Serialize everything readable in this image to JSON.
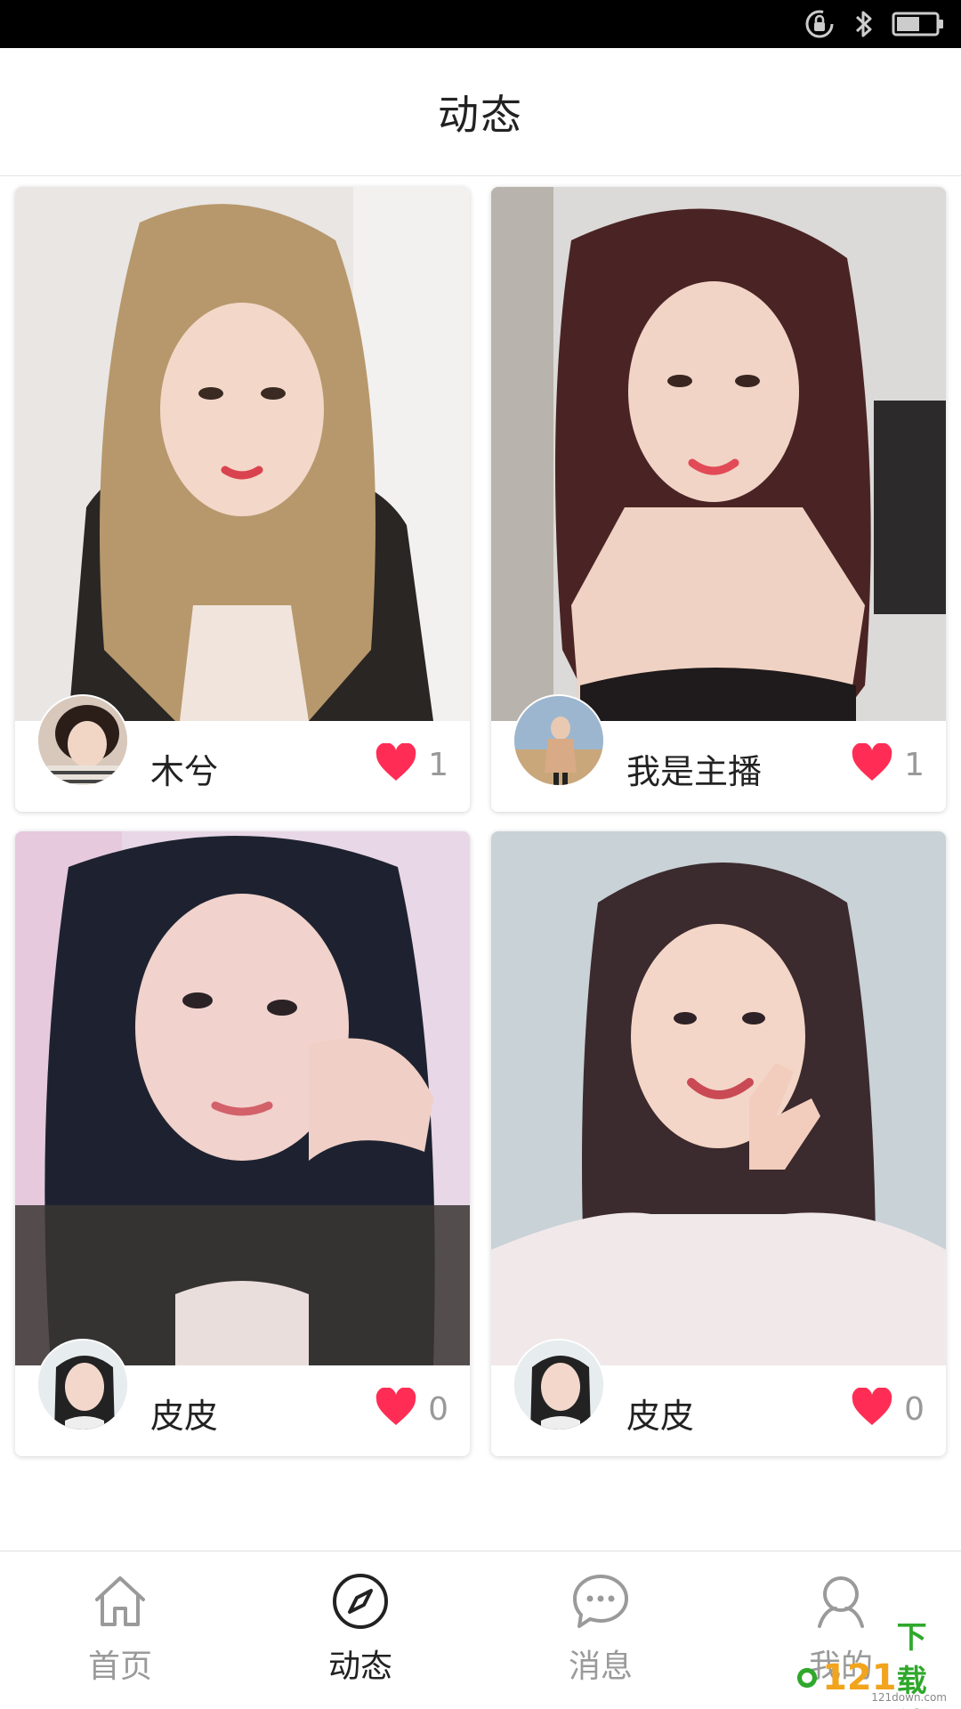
{
  "status_bar": {
    "icons": [
      "lock-rotation-icon",
      "bluetooth-icon",
      "battery-icon"
    ],
    "battery_level": 0.6
  },
  "header": {
    "title": "动态"
  },
  "feed": [
    {
      "name": "木兮",
      "likes": "1"
    },
    {
      "name": "我是主播",
      "likes": "1"
    },
    {
      "name": "皮皮",
      "likes": "0"
    },
    {
      "name": "皮皮",
      "likes": "0"
    }
  ],
  "nav": [
    {
      "label": "首页",
      "icon": "home-icon",
      "active": false
    },
    {
      "label": "动态",
      "icon": "compass-icon",
      "active": true
    },
    {
      "label": "消息",
      "icon": "chat-bubble-icon",
      "active": false
    },
    {
      "label": "我的",
      "icon": "person-icon",
      "active": false
    }
  ],
  "watermark": {
    "brand": "121下载站",
    "site": "121down.com"
  },
  "colors": {
    "heart": "#ff2d55",
    "active_nav": "#222222",
    "inactive_nav": "#9a9a9a"
  }
}
